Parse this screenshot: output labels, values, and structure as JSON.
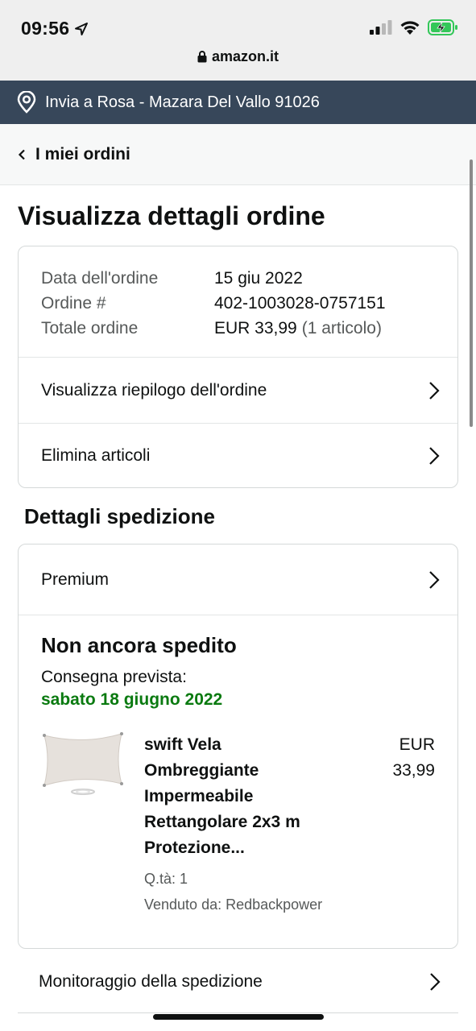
{
  "status_bar": {
    "time": "09:56",
    "url": "amazon.it",
    "battery_color": "#33c759"
  },
  "delivery": {
    "text": "Invia a Rosa - Mazara Del Vallo 91026"
  },
  "nav": {
    "back_label": "I miei ordini"
  },
  "page": {
    "title": "Visualizza dettagli ordine"
  },
  "order": {
    "date_label": "Data dell'ordine",
    "date_value": "15 giu 2022",
    "number_label": "Ordine #",
    "number_value": "402-1003028-0757151",
    "total_label": "Totale ordine",
    "total_value": "EUR 33,99",
    "total_items": "(1 articolo)",
    "summary_link": "Visualizza riepilogo dell'ordine",
    "delete_link": "Elimina articoli"
  },
  "shipping": {
    "section_title": "Dettagli spedizione",
    "method": "Premium",
    "status": "Non ancora spedito",
    "eta_label": "Consegna prevista:",
    "eta_date": "sabato 18 giugno 2022",
    "item": {
      "title_lines": [
        "swift Vela",
        "Ombreggiante",
        "Impermeabile",
        "Rettangolare 2x3 m",
        "Protezione..."
      ],
      "qty": "Q.tà: 1",
      "seller": "Venduto da: Redbackpower",
      "price_currency": "EUR",
      "price_value": "33,99"
    },
    "tracking_link": "Monitoraggio della spedizione"
  },
  "colors": {
    "delivery_bar": "#37475a",
    "eta_green": "#0a7a10"
  }
}
